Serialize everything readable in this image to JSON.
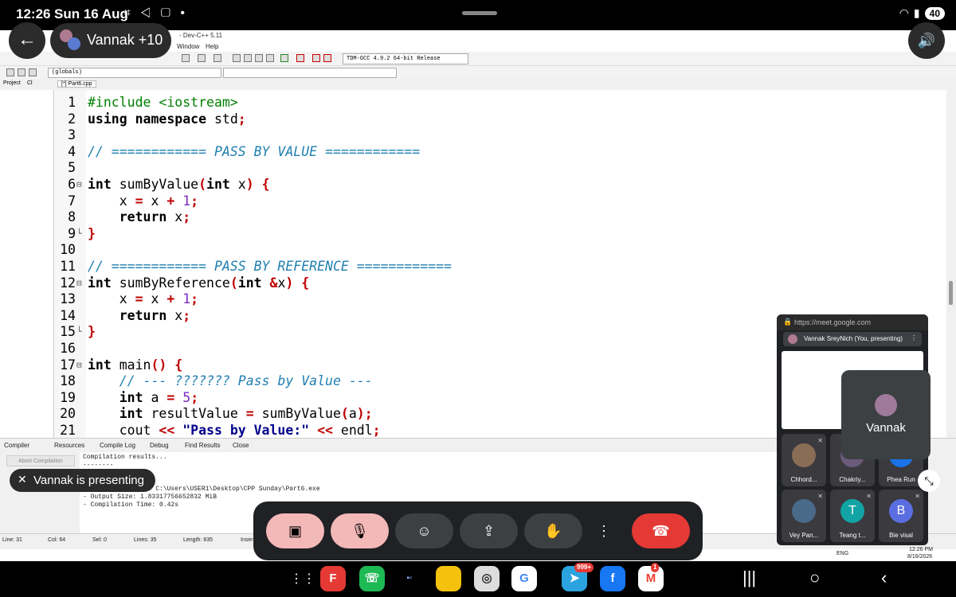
{
  "statusbar": {
    "time": "12:26",
    "date": "Sun 16 Aug",
    "battery": "40"
  },
  "ide": {
    "title": "- Dev-C++ 5.11",
    "menu": {
      "window": "Window",
      "help": "Help"
    },
    "compiler": "TDM-GCC 4.9.2 64-bit Release",
    "globals": "(globals)",
    "project_tab": "Project",
    "classes_tab": "Cl",
    "file_tab": "[*] Part6.cpp",
    "code": [
      {
        "n": "1",
        "fold": "",
        "h": "<span class=\"pp\">#include &lt;iostream&gt;</span>"
      },
      {
        "n": "2",
        "fold": "",
        "h": "<span class=\"kw\">using namespace</span> std<span class=\"op\">;</span>"
      },
      {
        "n": "3",
        "fold": "",
        "h": ""
      },
      {
        "n": "4",
        "fold": "",
        "h": "<span class=\"cm\">// ============ PASS BY VALUE ============</span>"
      },
      {
        "n": "5",
        "fold": "",
        "h": ""
      },
      {
        "n": "6",
        "fold": "⊟",
        "h": "<span class=\"kw\">int</span> sumByValue<span class=\"op\">(</span><span class=\"kw\">int</span> x<span class=\"op\">)</span> <span class=\"op\">{</span>"
      },
      {
        "n": "7",
        "fold": "",
        "h": "    x <span class=\"op\">=</span> x <span class=\"op\">+</span> <span class=\"num\">1</span><span class=\"op\">;</span>"
      },
      {
        "n": "8",
        "fold": "",
        "h": "    <span class=\"kw\">return</span> x<span class=\"op\">;</span>"
      },
      {
        "n": "9",
        "fold": "└",
        "h": "<span class=\"op\">}</span>"
      },
      {
        "n": "10",
        "fold": "",
        "h": ""
      },
      {
        "n": "11",
        "fold": "",
        "h": "<span class=\"cm\">// ============ PASS BY REFERENCE ============</span>"
      },
      {
        "n": "12",
        "fold": "⊟",
        "h": "<span class=\"kw\">int</span> sumByReference<span class=\"op\">(</span><span class=\"kw\">int</span> <span class=\"op\">&amp;</span>x<span class=\"op\">)</span> <span class=\"op\">{</span>"
      },
      {
        "n": "13",
        "fold": "",
        "h": "    x <span class=\"op\">=</span> x <span class=\"op\">+</span> <span class=\"num\">1</span><span class=\"op\">;</span>"
      },
      {
        "n": "14",
        "fold": "",
        "h": "    <span class=\"kw\">return</span> x<span class=\"op\">;</span>"
      },
      {
        "n": "15",
        "fold": "└",
        "h": "<span class=\"op\">}</span>"
      },
      {
        "n": "16",
        "fold": "",
        "h": ""
      },
      {
        "n": "17",
        "fold": "⊟",
        "h": "<span class=\"kw\">int</span> main<span class=\"op\">()</span> <span class=\"op\">{</span>"
      },
      {
        "n": "18",
        "fold": "",
        "h": "    <span class=\"cm\">// --- ??????? Pass by Value ---</span>"
      },
      {
        "n": "19",
        "fold": "",
        "h": "    <span class=\"kw\">int</span> a <span class=\"op\">=</span> <span class=\"num\">5</span><span class=\"op\">;</span>"
      },
      {
        "n": "20",
        "fold": "",
        "h": "    <span class=\"kw\">int</span> resultValue <span class=\"op\">=</span> sumByValue<span class=\"op\">(</span>a<span class=\"op\">);</span>"
      },
      {
        "n": "21",
        "fold": "",
        "h": "    cout <span class=\"op\">&lt;&lt;</span> <span class=\"str\">\"Pass by Value:\"</span> <span class=\"op\">&lt;&lt;</span> endl<span class=\"op\">;</span>"
      }
    ],
    "bottom_tabs": {
      "compiler": "Compiler",
      "resources": "Resources",
      "compile_log": "Compile Log",
      "debug": "Debug",
      "find_results": "Find Results",
      "close": "Close"
    },
    "abort": "Abort Compilation",
    "log": "Compilation results...\n--------\n\n\n- Output Filename: C:\\Users\\USER1\\Desktop\\CPP Sunday\\Part6.exe\n- Output Size: 1.83317756652832 MiB\n- Compilation Time: 0.42s",
    "status": {
      "line": "Line:   31",
      "col": "Col:   64",
      "sel": "Sel:   0",
      "lines": "Lines:   35",
      "length": "Length:   835",
      "insert": "Inser"
    },
    "tray": {
      "lang": "ENG",
      "time": "12:26 PM",
      "date": "8/16/2026"
    }
  },
  "meet": {
    "participants_label": "Vannak +10",
    "presenting_label": "Vannak is presenting",
    "url": "https://meet.google.com",
    "you_presenting": "Vannak SreyNich (You, presenting)",
    "self_name": "Vannak",
    "tiles": [
      {
        "name": "Chhord...",
        "initial": "",
        "color": "#8a6d55"
      },
      {
        "name": "Chakriy...",
        "initial": "",
        "color": "#6b5a7a"
      },
      {
        "name": "Phea Run",
        "initial": "P",
        "color": "#1a73e8"
      },
      {
        "name": "Vey Pan...",
        "initial": "",
        "color": "#4a6a8a"
      },
      {
        "name": "Teang t...",
        "initial": "T",
        "color": "#12a4a4"
      },
      {
        "name": "Bie visal",
        "initial": "B",
        "color": "#5b6ee1"
      }
    ],
    "colors": {
      "mic_off": "#f3b8b8",
      "end_call": "#e53935"
    }
  },
  "navbar": {
    "telegram_badge": "999+",
    "gmail_badge": "1"
  }
}
